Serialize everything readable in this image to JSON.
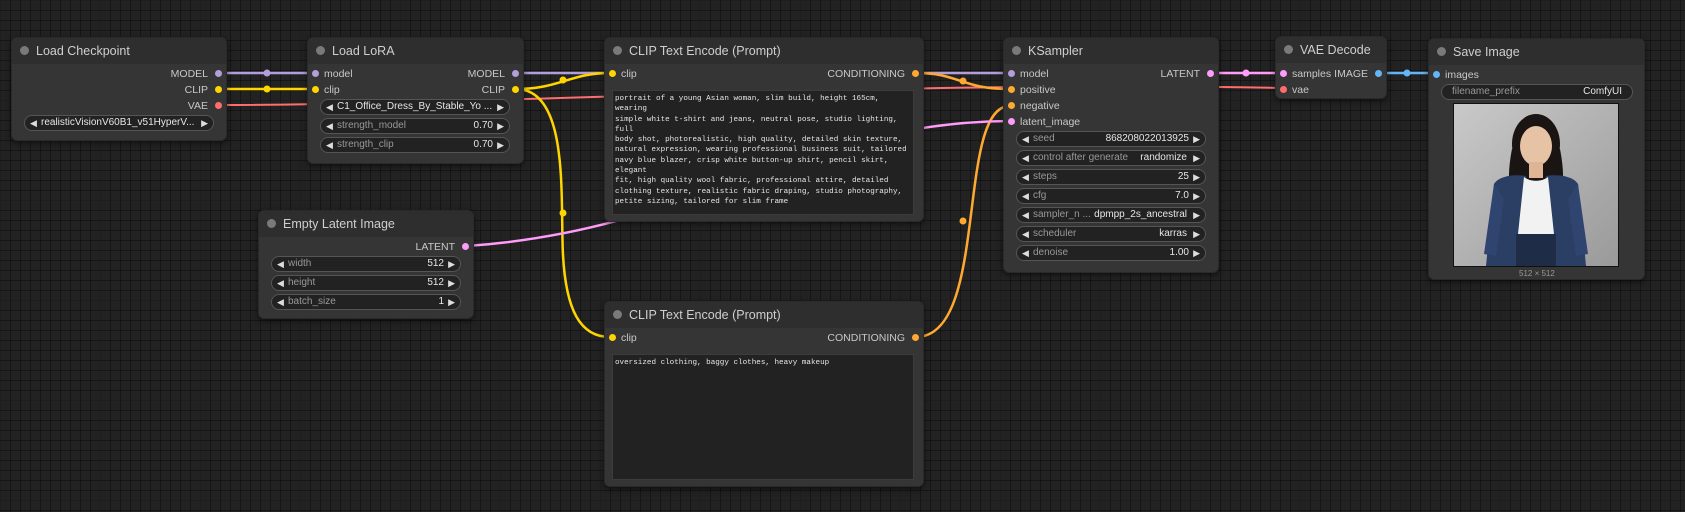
{
  "colors": {
    "model": "#b39ddb",
    "clip": "#ffd500",
    "vae": "#ff6e6e",
    "conditioning": "#ffa931",
    "latent": "#ff9cf9",
    "image": "#64b5f6"
  },
  "load_checkpoint": {
    "title": "Load Checkpoint",
    "out_model": "MODEL",
    "out_clip": "CLIP",
    "out_vae": "VAE",
    "ckpt_name": "realisticVisionV60B1_v51HyperV..."
  },
  "load_lora": {
    "title": "Load LoRA",
    "in_model": "model",
    "in_clip": "clip",
    "out_model": "MODEL",
    "out_clip": "CLIP",
    "lora_name": "C1_Office_Dress_By_Stable_Yo ...",
    "strength_model_label": "strength_model",
    "strength_model": "0.70",
    "strength_clip_label": "strength_clip",
    "strength_clip": "0.70"
  },
  "empty_latent": {
    "title": "Empty Latent Image",
    "out_latent": "LATENT",
    "width_label": "width",
    "width": "512",
    "height_label": "height",
    "height": "512",
    "batch_label": "batch_size",
    "batch": "1"
  },
  "clip_pos": {
    "title": "CLIP Text Encode (Prompt)",
    "in_clip": "clip",
    "out_cond": "CONDITIONING",
    "text": "portrait of a young Asian woman, slim build, height 165cm, wearing\nsimple white t-shirt and jeans, neutral pose, studio lighting, full\nbody shot, photorealistic, high quality, detailed skin texture,\nnatural expression, wearing professional business suit, tailored\nnavy blue blazer, crisp white button-up shirt, pencil skirt, elegant\nfit, high quality wool fabric, professional attire, detailed\nclothing texture, realistic fabric draping, studio photography,\npetite sizing, tailored for slim frame"
  },
  "clip_neg": {
    "title": "CLIP Text Encode (Prompt)",
    "in_clip": "clip",
    "out_cond": "CONDITIONING",
    "text": "oversized clothing, baggy clothes, heavy makeup"
  },
  "ksampler": {
    "title": "KSampler",
    "in_model": "model",
    "in_positive": "positive",
    "in_negative": "negative",
    "in_latent": "latent_image",
    "out_latent": "LATENT",
    "seed_label": "seed",
    "seed": "868208022013925",
    "control_label": "control after generate",
    "control": "randomize",
    "steps_label": "steps",
    "steps": "25",
    "cfg_label": "cfg",
    "cfg": "7.0",
    "sampler_label": "sampler_n ...",
    "sampler": "dpmpp_2s_ancestral",
    "scheduler_label": "scheduler",
    "scheduler": "karras",
    "denoise_label": "denoise",
    "denoise": "1.00"
  },
  "vae_decode": {
    "title": "VAE Decode",
    "in_samples": "samples",
    "in_vae": "vae",
    "out_image": "IMAGE"
  },
  "save_image": {
    "title": "Save Image",
    "in_images": "images",
    "prefix_label": "filename_prefix",
    "prefix": "ComfyUI",
    "size_label": "512 × 512"
  }
}
